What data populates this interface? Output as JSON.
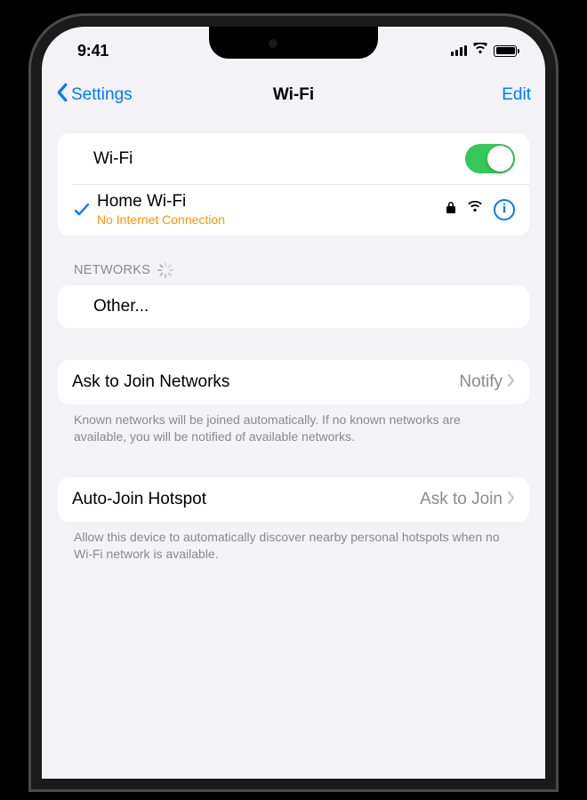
{
  "status": {
    "time": "9:41"
  },
  "nav": {
    "back": "Settings",
    "title": "Wi-Fi",
    "edit": "Edit"
  },
  "wifi": {
    "toggle_label": "Wi-Fi",
    "connected": {
      "name": "Home Wi-Fi",
      "status": "No Internet Connection"
    }
  },
  "sections": {
    "networks_header": "NETWORKS",
    "other": "Other..."
  },
  "ask_join": {
    "label": "Ask to Join Networks",
    "value": "Notify",
    "footer": "Known networks will be joined automatically. If no known networks are available, you will be notified of available networks."
  },
  "auto_hotspot": {
    "label": "Auto-Join Hotspot",
    "value": "Ask to Join",
    "footer": "Allow this device to automatically discover nearby personal hotspots when no Wi-Fi network is available."
  }
}
